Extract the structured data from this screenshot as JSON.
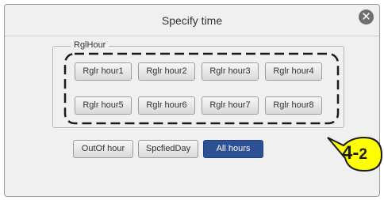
{
  "dialog": {
    "title": "Specify time",
    "close_icon": "close-icon"
  },
  "group": {
    "legend": "RglHour",
    "buttons": [
      {
        "label": "Rglr hour1"
      },
      {
        "label": "Rglr hour2"
      },
      {
        "label": "Rglr hour3"
      },
      {
        "label": "Rglr hour4"
      },
      {
        "label": "Rglr hour5"
      },
      {
        "label": "Rglr hour6"
      },
      {
        "label": "Rglr hour7"
      },
      {
        "label": "Rglr hour8"
      }
    ]
  },
  "mode_buttons": [
    {
      "label": "OutOf hour",
      "selected": false
    },
    {
      "label": "SpcfiedDay",
      "selected": false
    },
    {
      "label": "All hours",
      "selected": true
    }
  ],
  "callout": {
    "main": "4-",
    "sub": "2",
    "color": "#ffff00"
  },
  "colors": {
    "selected_button": "#2d4f93",
    "panel_background": "#f0f0f0"
  }
}
